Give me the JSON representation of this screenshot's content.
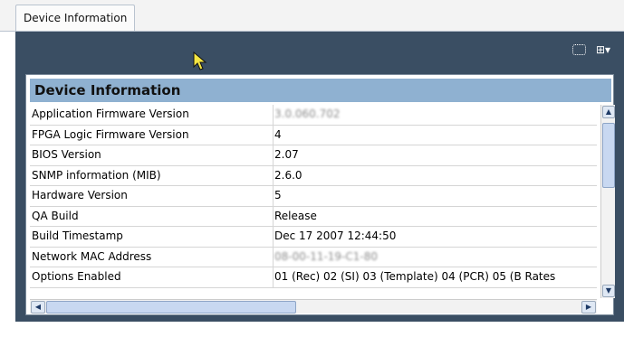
{
  "tab": {
    "label": "Device Information"
  },
  "panel": {
    "title": "Device Information"
  },
  "rows": [
    {
      "label": "Application Firmware Version",
      "value": "3.0.060.702"
    },
    {
      "label": "FPGA Logic Firmware Version",
      "value": "4"
    },
    {
      "label": "BIOS Version",
      "value": "2.07"
    },
    {
      "label": "SNMP information (MIB)",
      "value": "2.6.0"
    },
    {
      "label": "Hardware Version",
      "value": "5"
    },
    {
      "label": "QA Build",
      "value": "Release"
    },
    {
      "label": "Build Timestamp",
      "value": "Dec 17 2007 12:44:50"
    },
    {
      "label": "Network MAC Address",
      "value": "08-00-11-19-C1-80"
    },
    {
      "label": "Options Enabled",
      "value": "01 (Rec) 02 (SI) 03 (Template) 04 (PCR) 05 (B Rates"
    }
  ],
  "icons": {
    "select": "dashed-select-icon",
    "columns": "columns-menu-icon"
  }
}
